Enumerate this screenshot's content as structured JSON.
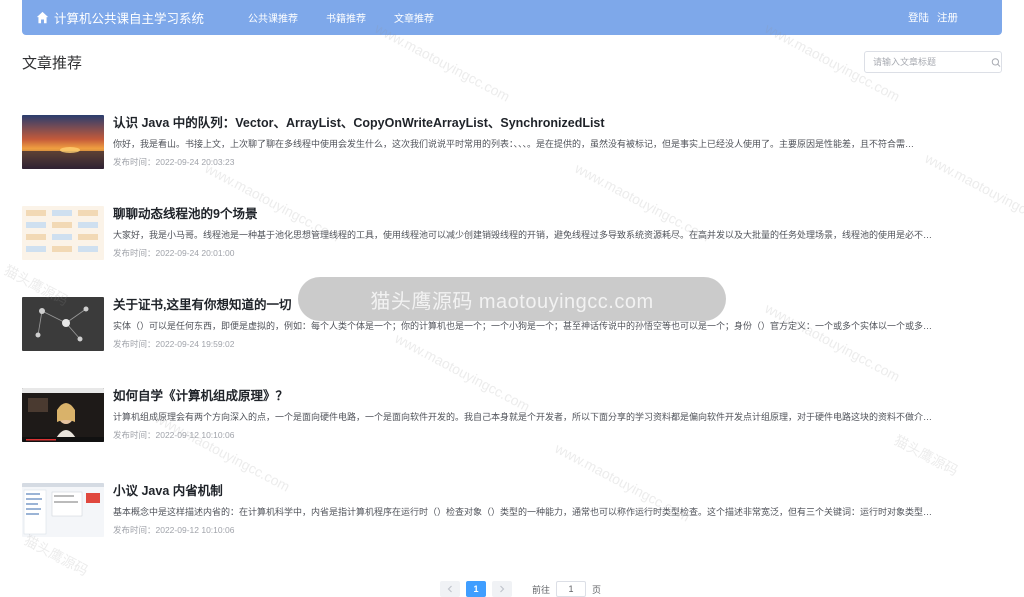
{
  "nav": {
    "brand": "计算机公共课自主学习系统",
    "links": [
      "公共课推荐",
      "书籍推荐",
      "文章推荐"
    ],
    "login": "登陆",
    "register": "注册"
  },
  "page": {
    "heading": "文章推荐",
    "search_placeholder": "请输入文章标题"
  },
  "articles": [
    {
      "title": "认识 Java 中的队列：Vector、ArrayList、CopyOnWriteArrayList、SynchronizedList",
      "summary": "你好，我是看山。书接上文，上次聊了聊在多线程中使用会发生什么，这次我们说说平时常用的列表：、、、。是在提供的，虽然没有被标记，但是事实上已经没人使用了。主要原因是性能差，且不符合需…",
      "date": "发布时间：2022-09-24 20:03:23"
    },
    {
      "title": "聊聊动态线程池的9个场景",
      "summary": "大家好，我是小马哥。线程池是一种基于池化思想管理线程的工具，使用线程池可以减少创建销毁线程的开销，避免线程过多导致系统资源耗尽。在高并发以及大批量的任务处理场景，线程池的使用是必不…",
      "date": "发布时间：2022-09-24 20:01:00"
    },
    {
      "title": "关于证书,这里有你想知道的一切",
      "summary": "实体（）可以是任何东西，即便是虚拟的，例如：每个人类个体是一个；你的计算机也是一个；一个小狗是一个；甚至神话传说中的孙悟空等也可以是一个；身份（）官方定义：一个或多个实体以一个或多…",
      "date": "发布时间：2022-09-24 19:59:02"
    },
    {
      "title": "如何自学《计算机组成原理》？",
      "summary": "计算机组成原理会有两个方向深入的点，一个是面向硬件电路，一个是面向软件开发的。我自己本身就是个开发者，所以下面分享的学习资料都是偏向软件开发点计组原理，对于硬件电路这块的资料不做介…",
      "date": "发布时间：2022-09-12 10:10:06"
    },
    {
      "title": "小议 Java 内省机制",
      "summary": "基本概念中是这样描述内省的：在计算机科学中，内省是指计算机程序在运行时（）检查对象（）类型的一种能力，通常也可以称作运行时类型检查。这个描述非常宽泛，但有三个关键词：运行时对象类型…",
      "date": "发布时间：2022-09-12 10:10:06"
    }
  ],
  "pagination": {
    "current": "1",
    "goto_label": "前往",
    "goto_value": "1",
    "unit": "页"
  },
  "watermark": {
    "text_cn": "猫头鹰源码",
    "text_url": "www.maotouyingcc.com",
    "banner": "猫头鹰源码 maotouyingcc.com"
  },
  "colors": {
    "navbar": "#7ea8ea",
    "accent": "#409eff"
  }
}
